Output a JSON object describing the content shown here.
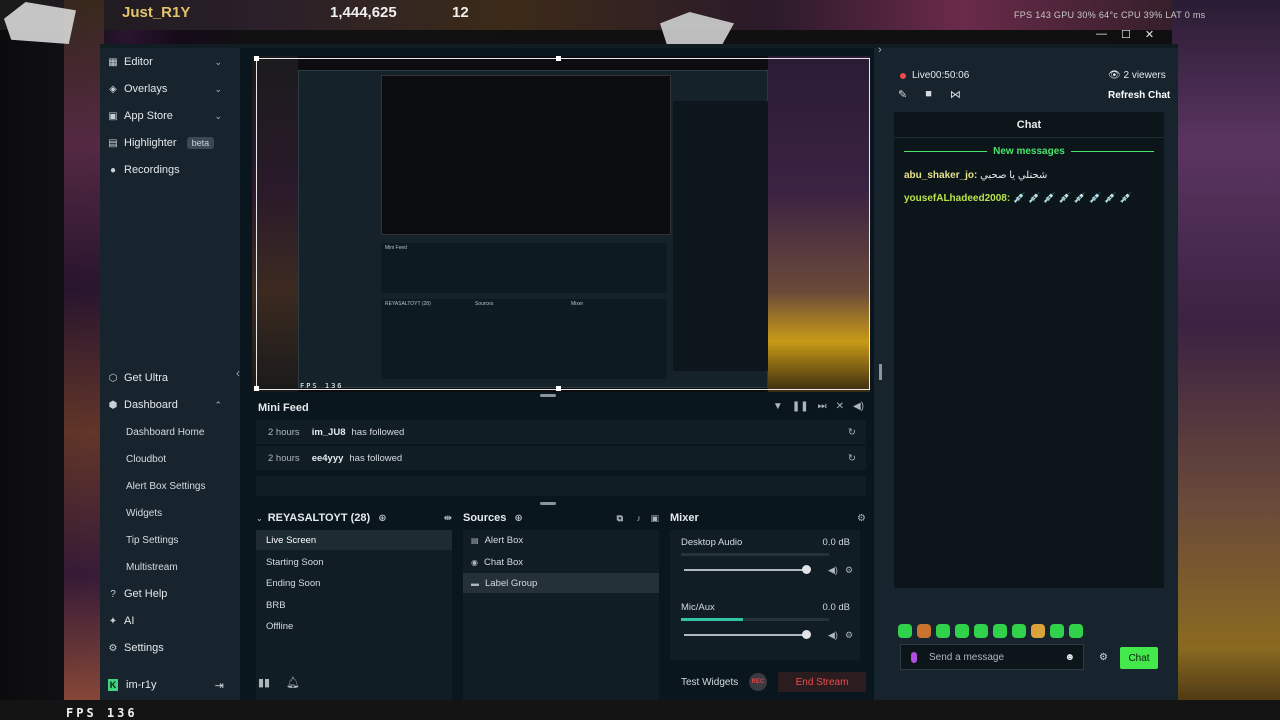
{
  "game_hud": {
    "player_name": "Just_R1Y",
    "coins": "1,444,625",
    "gems": "12",
    "perf": "FPS 143  GPU 30% 64°c  CPU 39%  LAT 0 ms",
    "fps_bottom": "FPS 136"
  },
  "sidebar": {
    "top_items": [
      {
        "label": "Editor"
      },
      {
        "label": "Overlays"
      },
      {
        "label": "App Store"
      },
      {
        "label": "Highlighter",
        "badge": "beta"
      },
      {
        "label": "Recordings"
      }
    ],
    "get_ultra": "Get Ultra",
    "dashboard": "Dashboard",
    "dashboard_items": [
      "Dashboard Home",
      "Cloudbot",
      "Alert Box Settings",
      "Widgets",
      "Tip Settings",
      "Multistream"
    ],
    "get_help": "Get Help",
    "ai": "AI",
    "settings": "Settings",
    "username": "im-r1y"
  },
  "preview": {
    "fps": "FPS 136",
    "inner_minifeed": "Mini Feed",
    "inner_scenes": "REYASALTOYT (28)",
    "inner_sources": "Sources",
    "inner_mixer": "Mixer"
  },
  "minifeed": {
    "title": "Mini Feed",
    "events": [
      {
        "time": "2 hours",
        "user": "im_JU8",
        "action": "has followed"
      },
      {
        "time": "2 hours",
        "user": "ee4yyy",
        "action": "has followed"
      }
    ]
  },
  "scenes": {
    "title": "REYASALTOYT (28)",
    "items": [
      "Live Screen",
      "Starting Soon",
      "Ending Soon",
      "BRB",
      "Offline"
    ],
    "active_index": 0
  },
  "sources": {
    "title": "Sources",
    "items": [
      "Alert Box",
      "Chat Box",
      "Label Group"
    ],
    "active_index": 2
  },
  "mixer": {
    "title": "Mixer",
    "channels": [
      {
        "name": "Desktop Audio",
        "value": "0.0 dB",
        "level": 0.0,
        "volume": 0.97
      },
      {
        "name": "Mic/Aux",
        "value": "0.0 dB",
        "level": 0.42,
        "volume": 0.97
      }
    ]
  },
  "bottombar": {
    "test_widgets": "Test Widgets",
    "rec": "REC",
    "end_stream": "End Stream"
  },
  "chat": {
    "live_label": "Live",
    "live_time": "00:50:06",
    "viewers": "2 viewers",
    "refresh": "Refresh Chat",
    "title": "Chat",
    "new_messages": "New messages",
    "messages": [
      {
        "user": "abu_shaker_jo:",
        "text": "شحنلي يا صحبي"
      },
      {
        "user": "yousefALhadeed2008:",
        "text": "💉 💉 💉 💉 💉 💉 💉 💉"
      }
    ],
    "placeholder": "Send a message",
    "send_button": "Chat"
  },
  "colors": {
    "accent_green": "#43e84b",
    "live_red": "#f04a4a",
    "end_stream_red": "#ef4b4b",
    "meter_teal": "#31c3a2"
  }
}
